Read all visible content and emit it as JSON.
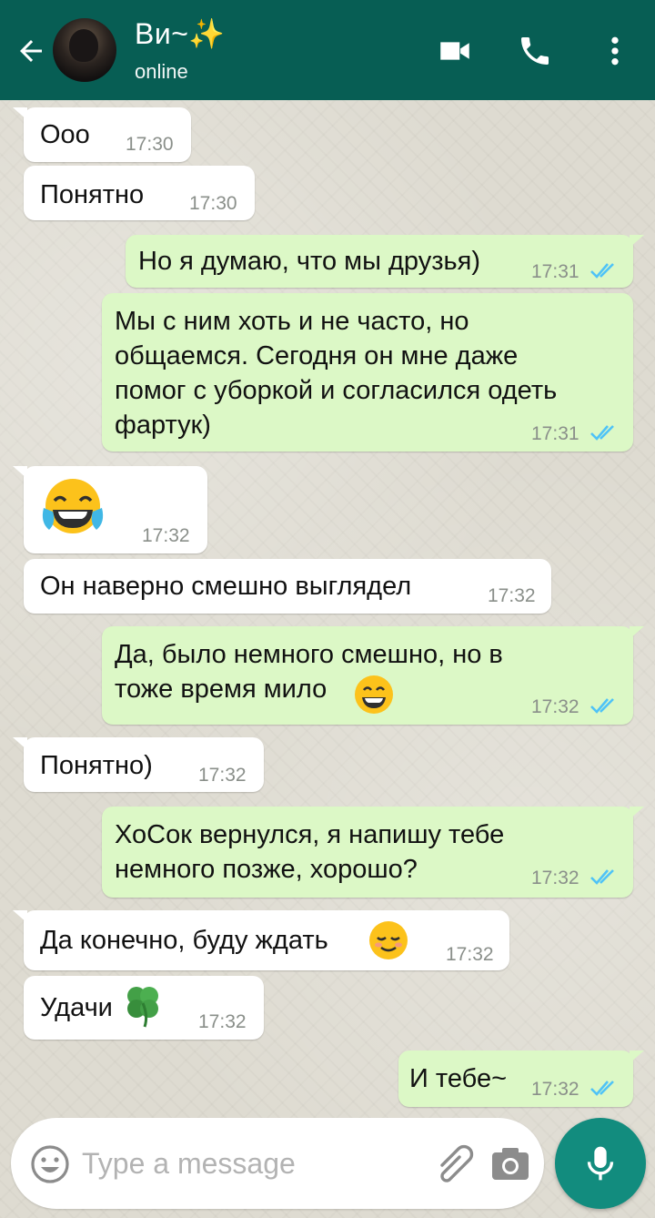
{
  "header": {
    "contact_name": "Ви~✨",
    "status": "online",
    "back_icon": "arrow-left-icon",
    "video_icon": "video-camera-icon",
    "call_icon": "phone-icon",
    "menu_icon": "more-vertical-icon",
    "color": "#075e54"
  },
  "messages": [
    {
      "dir": "in",
      "text": "Ооо",
      "time": "17:30"
    },
    {
      "dir": "in",
      "text": "Понятно",
      "time": "17:30"
    },
    {
      "dir": "out",
      "text": "Но я думаю, что мы друзья)",
      "time": "17:31",
      "read": true
    },
    {
      "dir": "out",
      "text": "Мы с ним хоть и не часто, но\nобщаемся. Сегодня он мне даже\nпомог с уборкой и согласился одеть\nфартук)",
      "time": "17:31",
      "read": true
    },
    {
      "dir": "in",
      "text": "",
      "emoji": "tears-of-joy-emoji",
      "time": "17:32"
    },
    {
      "dir": "in",
      "text": "Он наверно смешно выглядел",
      "time": "17:32"
    },
    {
      "dir": "out",
      "text": "Да, было немного смешно, но в\nтоже время мило",
      "emoji": "grinning-emoji",
      "time": "17:32",
      "read": true
    },
    {
      "dir": "in",
      "text": "Понятно)",
      "time": "17:32"
    },
    {
      "dir": "out",
      "text": "ХоСок вернулся, я напишу тебе\nнемного позже, хорошо?",
      "time": "17:32",
      "read": true
    },
    {
      "dir": "in",
      "text": "Да конечно, буду ждать ",
      "emoji": "relieved-emoji",
      "time": "17:32"
    },
    {
      "dir": "in",
      "text": "Удачи",
      "emoji": "four-leaf-clover-emoji",
      "time": "17:32"
    },
    {
      "dir": "out",
      "text": "И тебе~",
      "time": "17:32",
      "read": true
    }
  ],
  "composer": {
    "placeholder": "Type a message",
    "emoji_icon": "smiley-icon",
    "attach_icon": "paperclip-icon",
    "camera_icon": "camera-icon",
    "mic_icon": "microphone-icon"
  },
  "colors": {
    "incoming_bubble": "#ffffff",
    "outgoing_bubble": "#dcf8c6",
    "read_ticks": "#4fc3f7",
    "mic_button": "#128c7e"
  }
}
